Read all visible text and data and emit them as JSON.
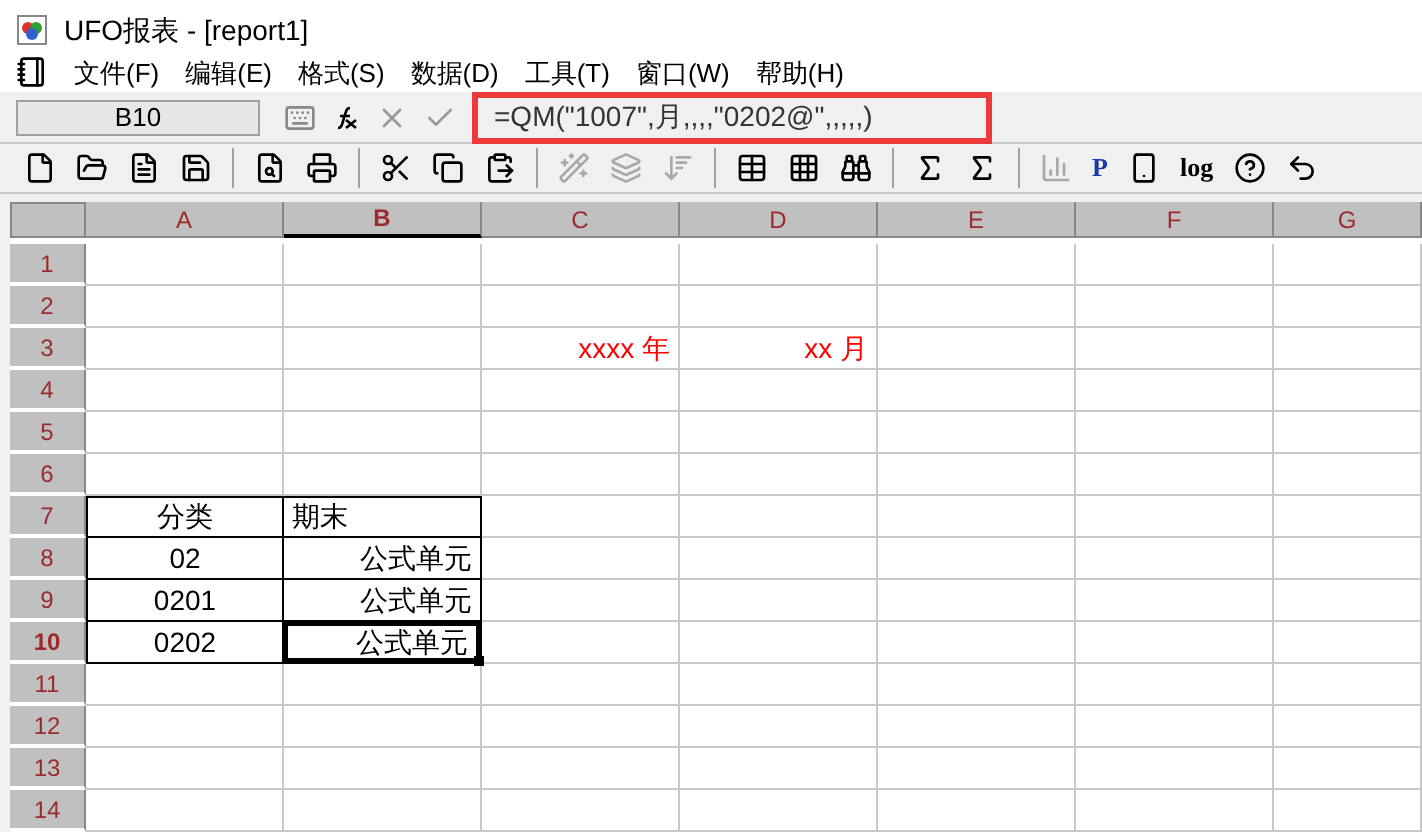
{
  "window": {
    "title": "UFO报表 - [report1]"
  },
  "menu": [
    "文件(F)",
    "编辑(E)",
    "格式(S)",
    "数据(D)",
    "工具(T)",
    "窗口(W)",
    "帮助(H)"
  ],
  "formula_bar": {
    "cell_name": "B10",
    "formula": "=QM(\"1007\",月,,,,\"0202@\",,,,,)",
    "highlighted": true
  },
  "toolbar": [
    {
      "kind": "icon",
      "disabled": false
    },
    {
      "kind": "icon",
      "disabled": false
    },
    {
      "kind": "icon",
      "disabled": false
    },
    {
      "kind": "icon",
      "disabled": false
    },
    {
      "kind": "separator"
    },
    {
      "kind": "icon",
      "disabled": false
    },
    {
      "kind": "icon",
      "disabled": false
    },
    {
      "kind": "separator"
    },
    {
      "kind": "icon",
      "disabled": false
    },
    {
      "kind": "icon",
      "disabled": false
    },
    {
      "kind": "icon",
      "disabled": false
    },
    {
      "kind": "separator"
    },
    {
      "kind": "icon",
      "disabled": true
    },
    {
      "kind": "icon",
      "disabled": true
    },
    {
      "kind": "icon",
      "disabled": true
    },
    {
      "kind": "separator"
    },
    {
      "kind": "icon",
      "disabled": false
    },
    {
      "kind": "icon",
      "disabled": false
    },
    {
      "kind": "icon",
      "disabled": false
    },
    {
      "kind": "separator"
    },
    {
      "kind": "icon",
      "disabled": false
    },
    {
      "kind": "icon",
      "disabled": false
    },
    {
      "kind": "separator"
    },
    {
      "kind": "icon",
      "disabled": true
    },
    {
      "kind": "text",
      "label": "P",
      "disabled": false
    },
    {
      "kind": "icon",
      "disabled": false
    },
    {
      "kind": "text",
      "label": "log",
      "disabled": false
    },
    {
      "kind": "icon",
      "disabled": false
    },
    {
      "kind": "icon",
      "disabled": false
    }
  ],
  "sheet": {
    "columns": [
      {
        "label": "A",
        "selected": false
      },
      {
        "label": "B",
        "selected": true
      },
      {
        "label": "C",
        "selected": false
      },
      {
        "label": "D",
        "selected": false
      },
      {
        "label": "E",
        "selected": false
      },
      {
        "label": "F",
        "selected": false
      },
      {
        "label": "G",
        "selected": false
      }
    ],
    "rows": [
      {
        "label": "1",
        "selected": false,
        "cells": []
      },
      {
        "label": "2",
        "selected": false,
        "cells": []
      },
      {
        "label": "3",
        "selected": false,
        "cells": [
          {
            "kind": "empty"
          },
          {
            "kind": "empty"
          },
          {
            "kind": "text",
            "text": "xxxx 年",
            "centered": false,
            "right_aligned": true,
            "color": "#ff0000",
            "bordered": false,
            "selected": false
          },
          {
            "kind": "text",
            "text": "xx 月",
            "centered": false,
            "right_aligned": true,
            "color": "#ff0000",
            "bordered": false,
            "selected": false
          }
        ]
      },
      {
        "label": "4",
        "selected": false,
        "cells": []
      },
      {
        "label": "5",
        "selected": false,
        "cells": []
      },
      {
        "label": "6",
        "selected": false,
        "cells": []
      },
      {
        "label": "7",
        "selected": false,
        "cells": [
          {
            "kind": "text",
            "text": "分类",
            "centered": true,
            "color": "#000000",
            "bordered": true,
            "selected": false
          },
          {
            "kind": "text",
            "text": "期末",
            "centered": false,
            "right_aligned": false,
            "color": "#000000",
            "bordered": true,
            "selected": false
          }
        ]
      },
      {
        "label": "8",
        "selected": false,
        "cells": [
          {
            "kind": "text",
            "text": "02",
            "centered": true,
            "color": "#000000",
            "bordered": true,
            "selected": false
          },
          {
            "kind": "text",
            "text": "公式单元",
            "centered": false,
            "right_aligned": true,
            "color": "#000000",
            "bordered": true,
            "selected": false
          }
        ]
      },
      {
        "label": "9",
        "selected": false,
        "cells": [
          {
            "kind": "text",
            "text": "0201",
            "centered": true,
            "color": "#000000",
            "bordered": true,
            "selected": false
          },
          {
            "kind": "text",
            "text": "公式单元",
            "centered": false,
            "right_aligned": true,
            "color": "#000000",
            "bordered": true,
            "selected": false
          }
        ]
      },
      {
        "label": "10",
        "selected": true,
        "cells": [
          {
            "kind": "text",
            "text": "0202",
            "centered": true,
            "color": "#000000",
            "bordered": true,
            "selected": false
          },
          {
            "kind": "text",
            "text": "公式单元",
            "centered": false,
            "right_aligned": true,
            "color": "#000000",
            "bordered": true,
            "selected": true
          }
        ]
      },
      {
        "label": "11",
        "selected": false,
        "cells": []
      },
      {
        "label": "12",
        "selected": false,
        "cells": []
      },
      {
        "label": "13",
        "selected": false,
        "cells": []
      },
      {
        "label": "14",
        "selected": false,
        "cells": []
      }
    ]
  }
}
